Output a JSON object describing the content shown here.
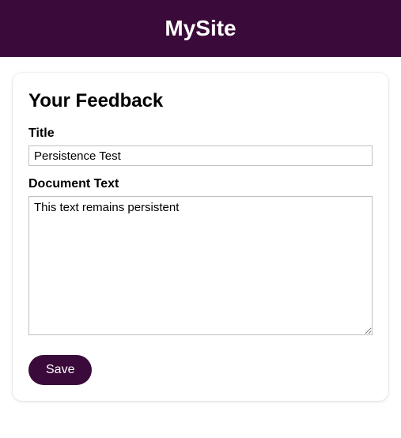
{
  "header": {
    "site_title": "MySite"
  },
  "form": {
    "heading": "Your Feedback",
    "title_label": "Title",
    "title_value": "Persistence Test",
    "document_label": "Document Text",
    "document_value": "This text remains persistent",
    "save_label": "Save"
  },
  "colors": {
    "brand_bg": "#3a0a3a",
    "brand_fg": "#ffffff"
  }
}
